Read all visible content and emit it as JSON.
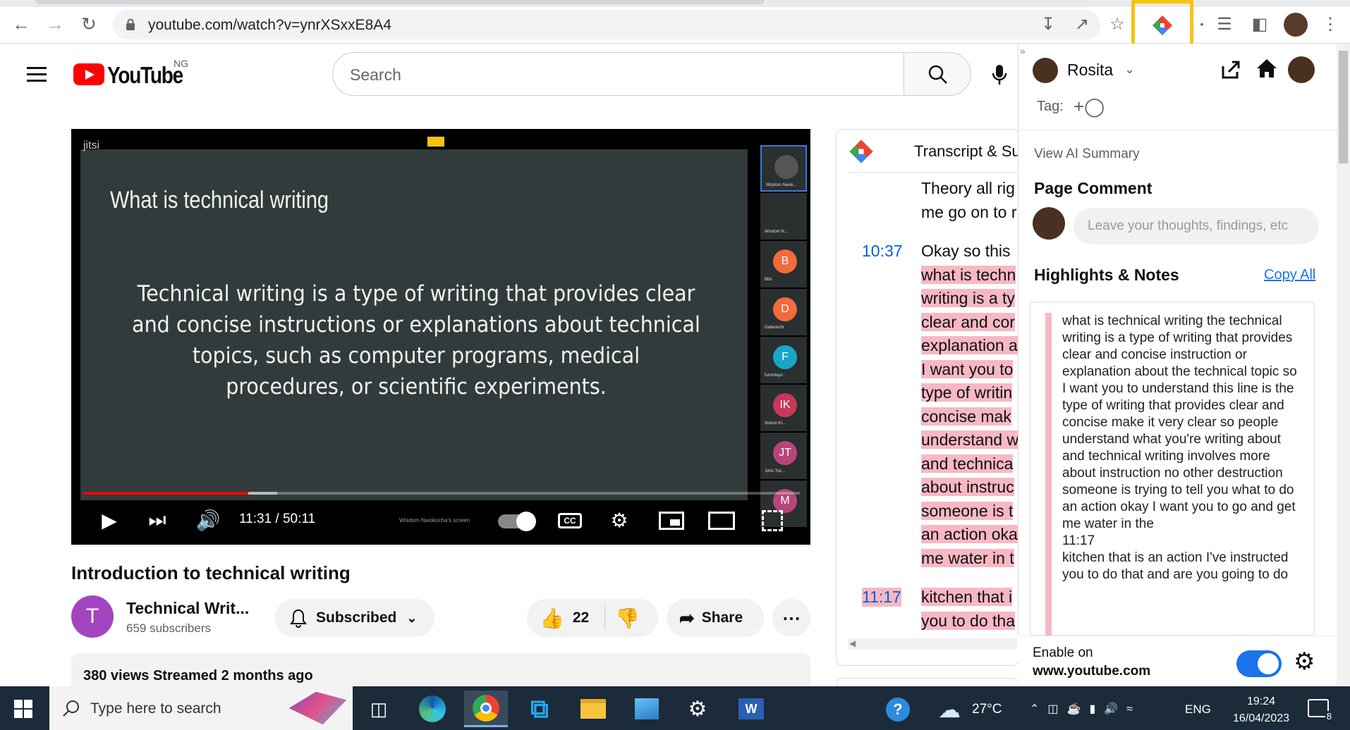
{
  "browser": {
    "url": "youtube.com/watch?v=ynrXSxxE8A4"
  },
  "youtube": {
    "logo_text": "YouTube",
    "country": "NG",
    "search_placeholder": "Search"
  },
  "video": {
    "platform_label": "jitsi",
    "slide_title": "What is technical writing",
    "slide_body": "Technical writing is a type of writing that provides clear and concise instructions or explanations about technical topics, such as computer programs, medical procedures, or scientific experiments.",
    "timecode": "11:31 / 50:11",
    "progress_fraction": 0.23,
    "screen_label": "Wisdom Nwokocha's screen",
    "participants": [
      {
        "initials": "",
        "label": "Wisdom Nwok...",
        "color": "#555555"
      },
      {
        "initials": "",
        "label": "Wisdom N...",
        "color": "#2a2f30"
      },
      {
        "initials": "B",
        "label": "Bibi",
        "color": "#f26b3a"
      },
      {
        "initials": "D",
        "label": "Daberechi",
        "color": "#f26b3a"
      },
      {
        "initials": "F",
        "label": "funmilayo",
        "color": "#1aa6c9"
      },
      {
        "initials": "IK",
        "label": "Ibukun Ki...",
        "color": "#c8385a"
      },
      {
        "initials": "JT",
        "label": "John Ton...",
        "color": "#b8457a"
      },
      {
        "initials": "M",
        "label": "",
        "color": "#b8457a"
      }
    ],
    "title": "Introduction to technical writing",
    "channel_initial": "T",
    "channel_name": "Technical Writ...",
    "subscribers": "659 subscribers",
    "subscribed_label": "Subscribed",
    "like_count": "22",
    "share_label": "Share",
    "meta": "380 views  Streamed 2 months ago"
  },
  "transcript": {
    "title": "Transcript & Su",
    "entries": [
      {
        "time": "",
        "lines": [
          "Theory all rig",
          "me go on to r"
        ],
        "highlight": false
      },
      {
        "time": "10:37",
        "lines": [
          "Okay so this",
          "what is techn",
          "writing is a ty",
          "clear and cor",
          "explanation a",
          "I want you to",
          "type of writin",
          "concise mak",
          "understand w",
          "and technica",
          "about instruc",
          "someone is t",
          "an action oka",
          "me water in t"
        ],
        "highlight": true
      },
      {
        "time": "11:17",
        "lines": [
          "kitchen that i",
          "you to do tha"
        ],
        "highlight": true
      }
    ]
  },
  "extension": {
    "user_name": "Rosita",
    "tag_label": "Tag:",
    "ai_summary": "View AI Summary",
    "page_comment": "Page Comment",
    "comment_placeholder": "Leave your thoughts, findings, etc",
    "highlights_title": "Highlights & Notes",
    "copy_all": "Copy All",
    "note_text": "what is technical writing the technical writing is a type of writing that provides clear and concise instruction or explanation about the technical topic so I want you to understand this line is the type of writing that provides clear and concise make it very clear so people understand what you're writing about and technical writing involves more about instruction no other destruction someone is trying to tell you what to do an action okay I want you to go and get me water in the\n11:17\nkitchen that is an action I've instructed you to do that and are you going to do",
    "enable_label": "Enable on",
    "site": "www.youtube.com",
    "enabled": true
  },
  "taskbar": {
    "search_placeholder": "Type here to search",
    "temperature": "27°C",
    "language": "ENG",
    "time": "19:24",
    "date": "16/04/2023",
    "notification_count": "8"
  }
}
